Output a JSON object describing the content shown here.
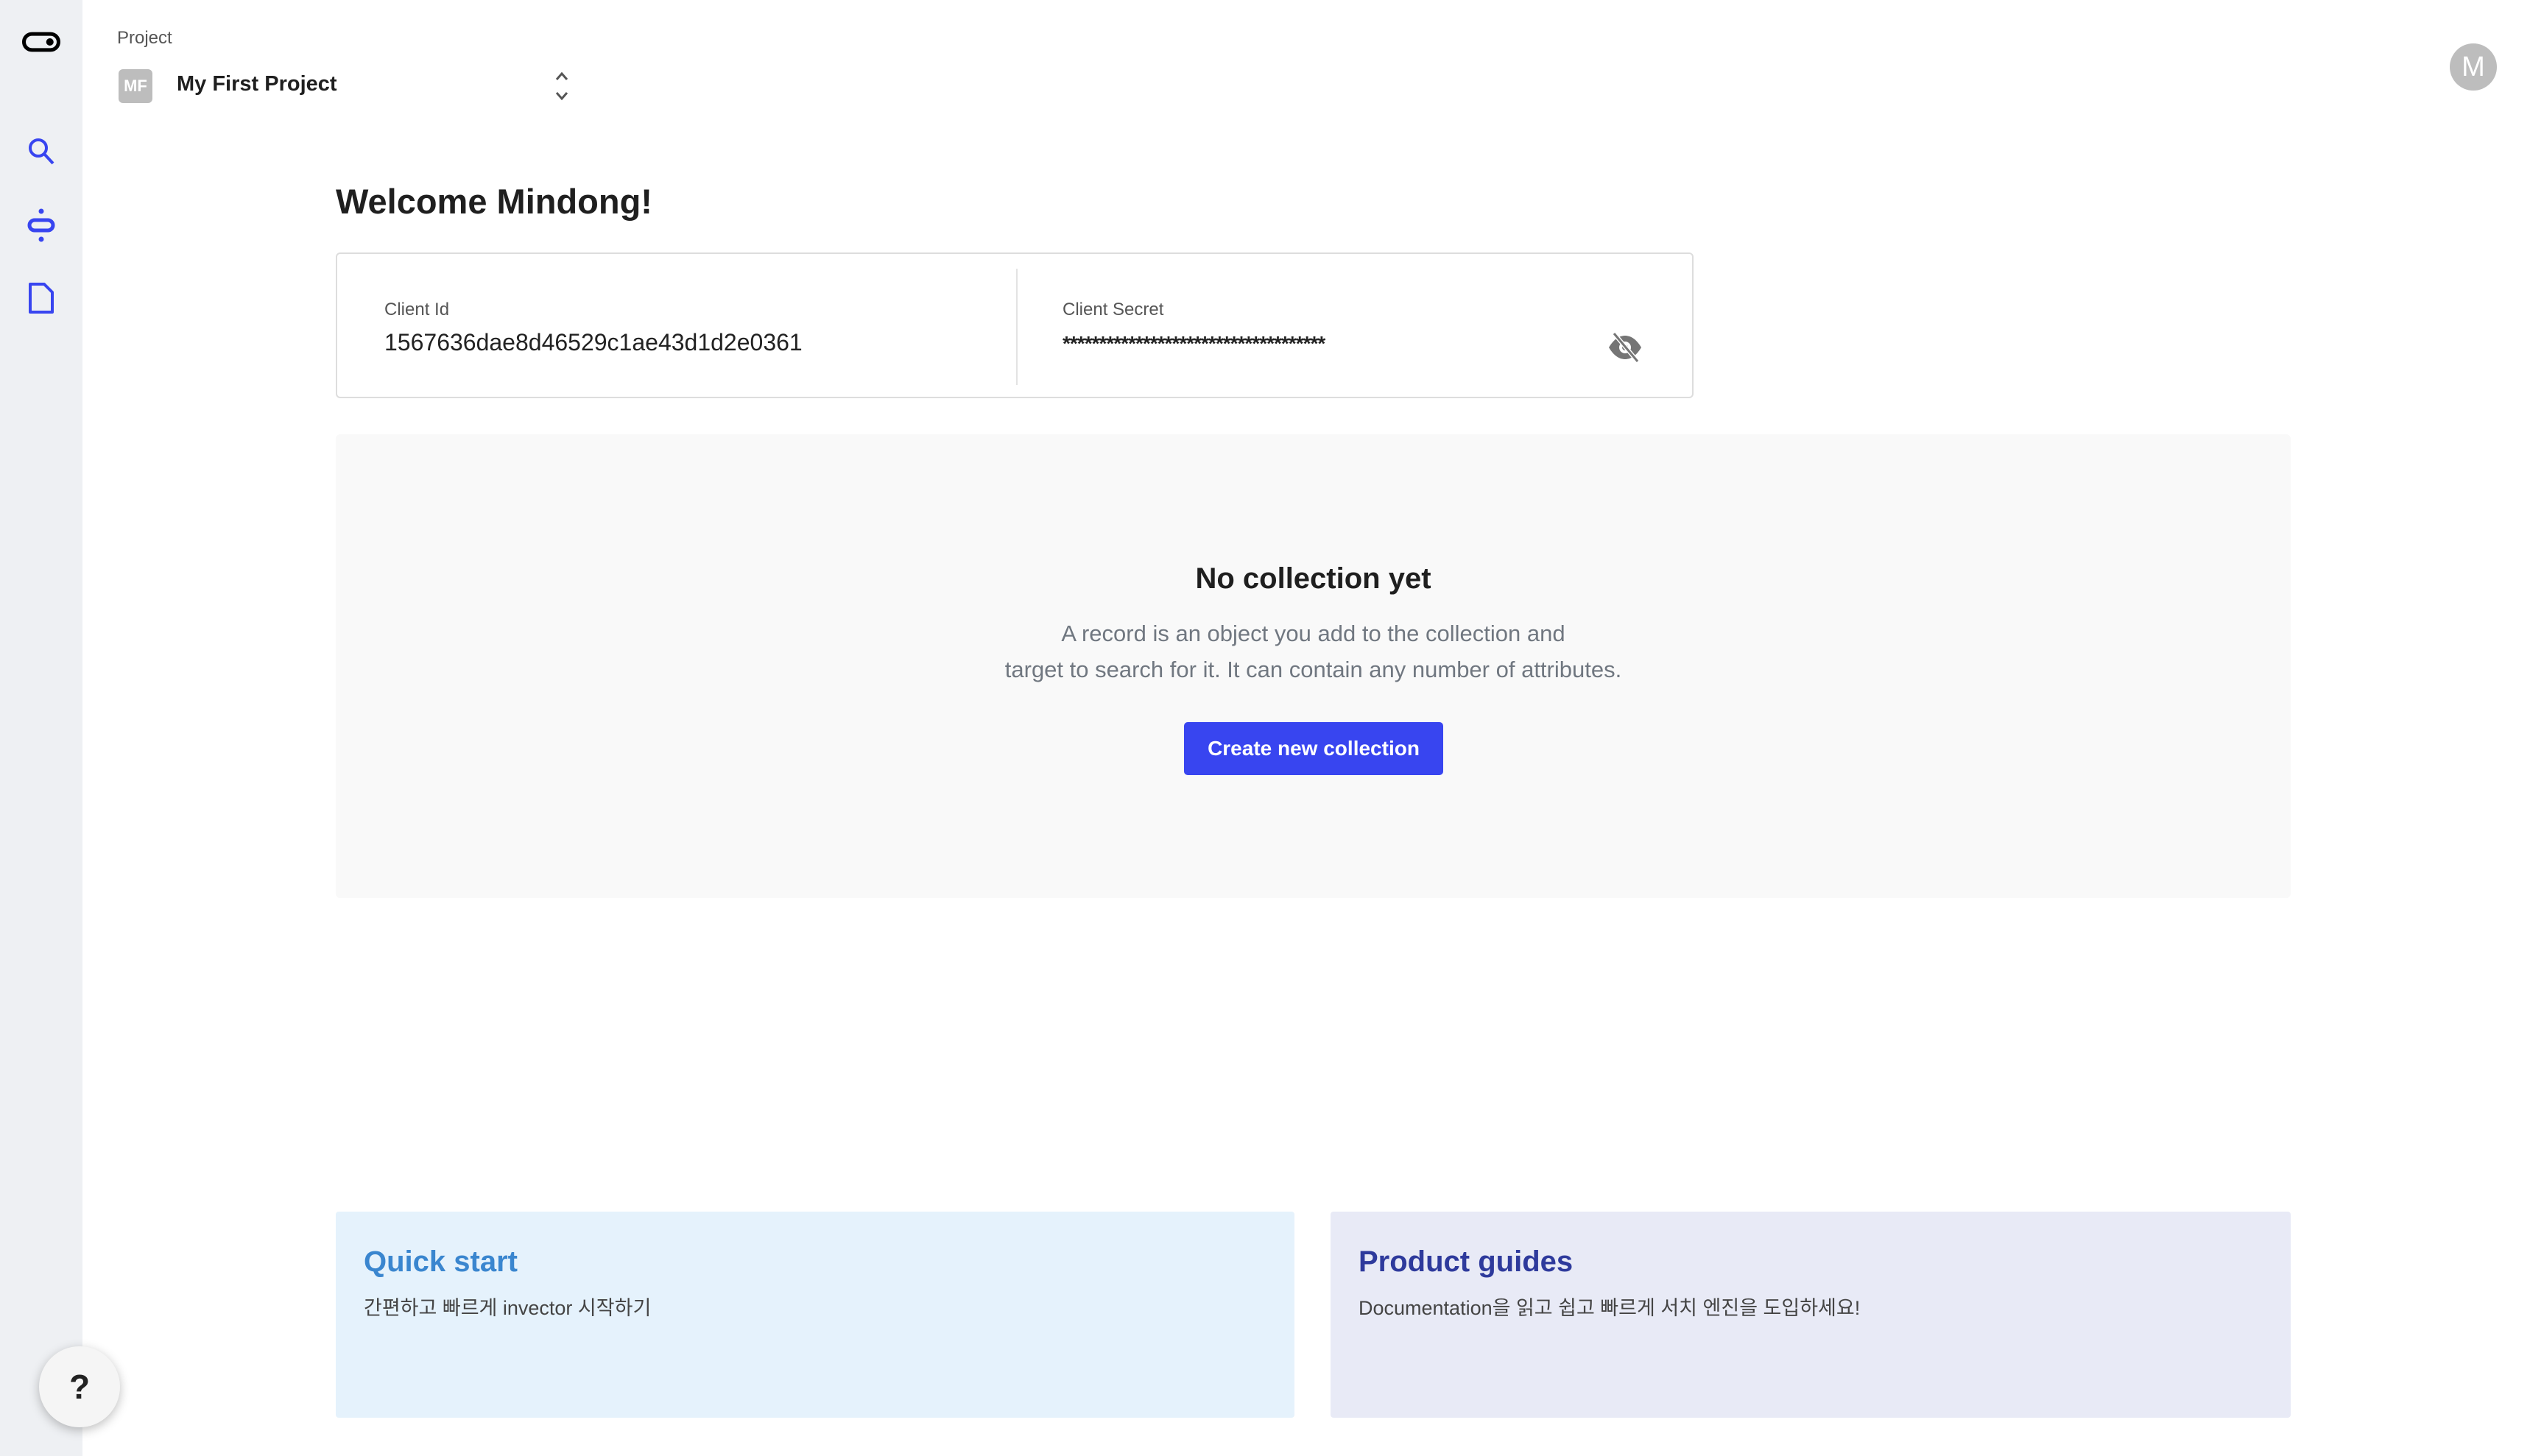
{
  "sidebar": {
    "items": [
      {
        "icon": "logo-toggle-icon"
      },
      {
        "icon": "search-icon"
      },
      {
        "icon": "link-icon"
      },
      {
        "icon": "document-icon"
      }
    ],
    "help_label": "?"
  },
  "header": {
    "project_label": "Project",
    "project_initials": "MF",
    "project_name": "My First Project",
    "avatar_initial": "M"
  },
  "main": {
    "welcome": "Welcome Mindong!",
    "client_id_label": "Client Id",
    "client_id": "1567636dae8d46529c1ae43d1d2e0361",
    "client_secret_label": "Client Secret",
    "client_secret": "************************************",
    "empty_title": "No collection yet",
    "empty_desc_1": "A record is an object you add to the collection and",
    "empty_desc_2": "target to search for it. It can contain any number of attributes.",
    "create_button": "Create new collection"
  },
  "cards": [
    {
      "title": "Quick start",
      "subtitle": "간편하고 빠르게 invector 시작하기",
      "bg": "#e5f2fc",
      "title_color": "#3a86cf"
    },
    {
      "title": "Product guides",
      "subtitle": "Documentation을 읽고 쉽고 빠르게 서치 엔진을 도입하세요!",
      "bg": "#e8eaf6",
      "title_color": "#2e3a9c"
    }
  ],
  "colors": {
    "accent": "#3845f0",
    "sidebar_bg": "#eef0f3"
  }
}
